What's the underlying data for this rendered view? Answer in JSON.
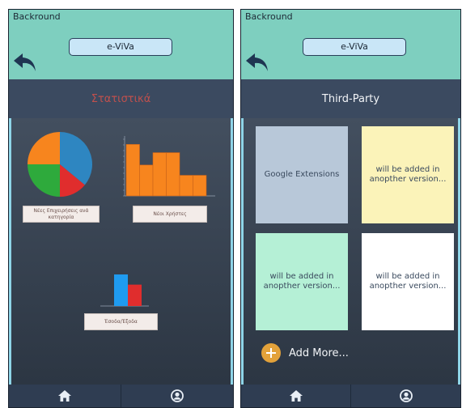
{
  "left_screen": {
    "header_label": "Backround",
    "app_name": "e-ViVa",
    "title": "Στατιστικά",
    "pie_label": "Νέες Επιχειρήσεις ανά κατηγορία",
    "bar_label": "Νέοι Χρήστες",
    "io_label": "Έσοδα/Έξοδα"
  },
  "right_screen": {
    "header_label": "Backround",
    "app_name": "e-ViVa",
    "title": "Third-Party",
    "tiles": [
      {
        "label": "Google Extensions",
        "color": "#b8c8d9"
      },
      {
        "label": "will be added in anopther version...",
        "color": "#fbf3b9"
      },
      {
        "label": "will be added in anopther version...",
        "color": "#b5f0d6"
      },
      {
        "label": "will be added in anopther version...",
        "color": "#ffffff"
      }
    ],
    "add_more": "Add More..."
  },
  "footer": {
    "home_icon": "home-icon",
    "profile_icon": "user-icon"
  },
  "colors": {
    "header": "#7ecfbf",
    "title_bar": "#3b4a60",
    "accent_red": "#c0504d",
    "add_button": "#e3a23a"
  },
  "chart_data": [
    {
      "type": "pie",
      "slices": [
        {
          "value": 36,
          "color": "#2e86c1"
        },
        {
          "value": 14,
          "color": "#e02d2d"
        },
        {
          "value": 25,
          "color": "#2eaa3c"
        },
        {
          "value": 25,
          "color": "#f7851e"
        }
      ],
      "legend": "Νέες Επιχειρήσεις ανά κατηγορία"
    },
    {
      "type": "bar",
      "values": [
        100,
        60,
        84,
        84,
        40,
        40
      ],
      "color": "#f7851e",
      "ylim": [
        0,
        110
      ],
      "legend": "Νέοι Χρήστες"
    },
    {
      "type": "bar",
      "series": [
        {
          "value": 62,
          "color": "#1f9bf0"
        },
        {
          "value": 42,
          "color": "#e02d2d"
        }
      ],
      "ylim": [
        0,
        70
      ],
      "legend": "Έσοδα/Έξοδα"
    }
  ]
}
